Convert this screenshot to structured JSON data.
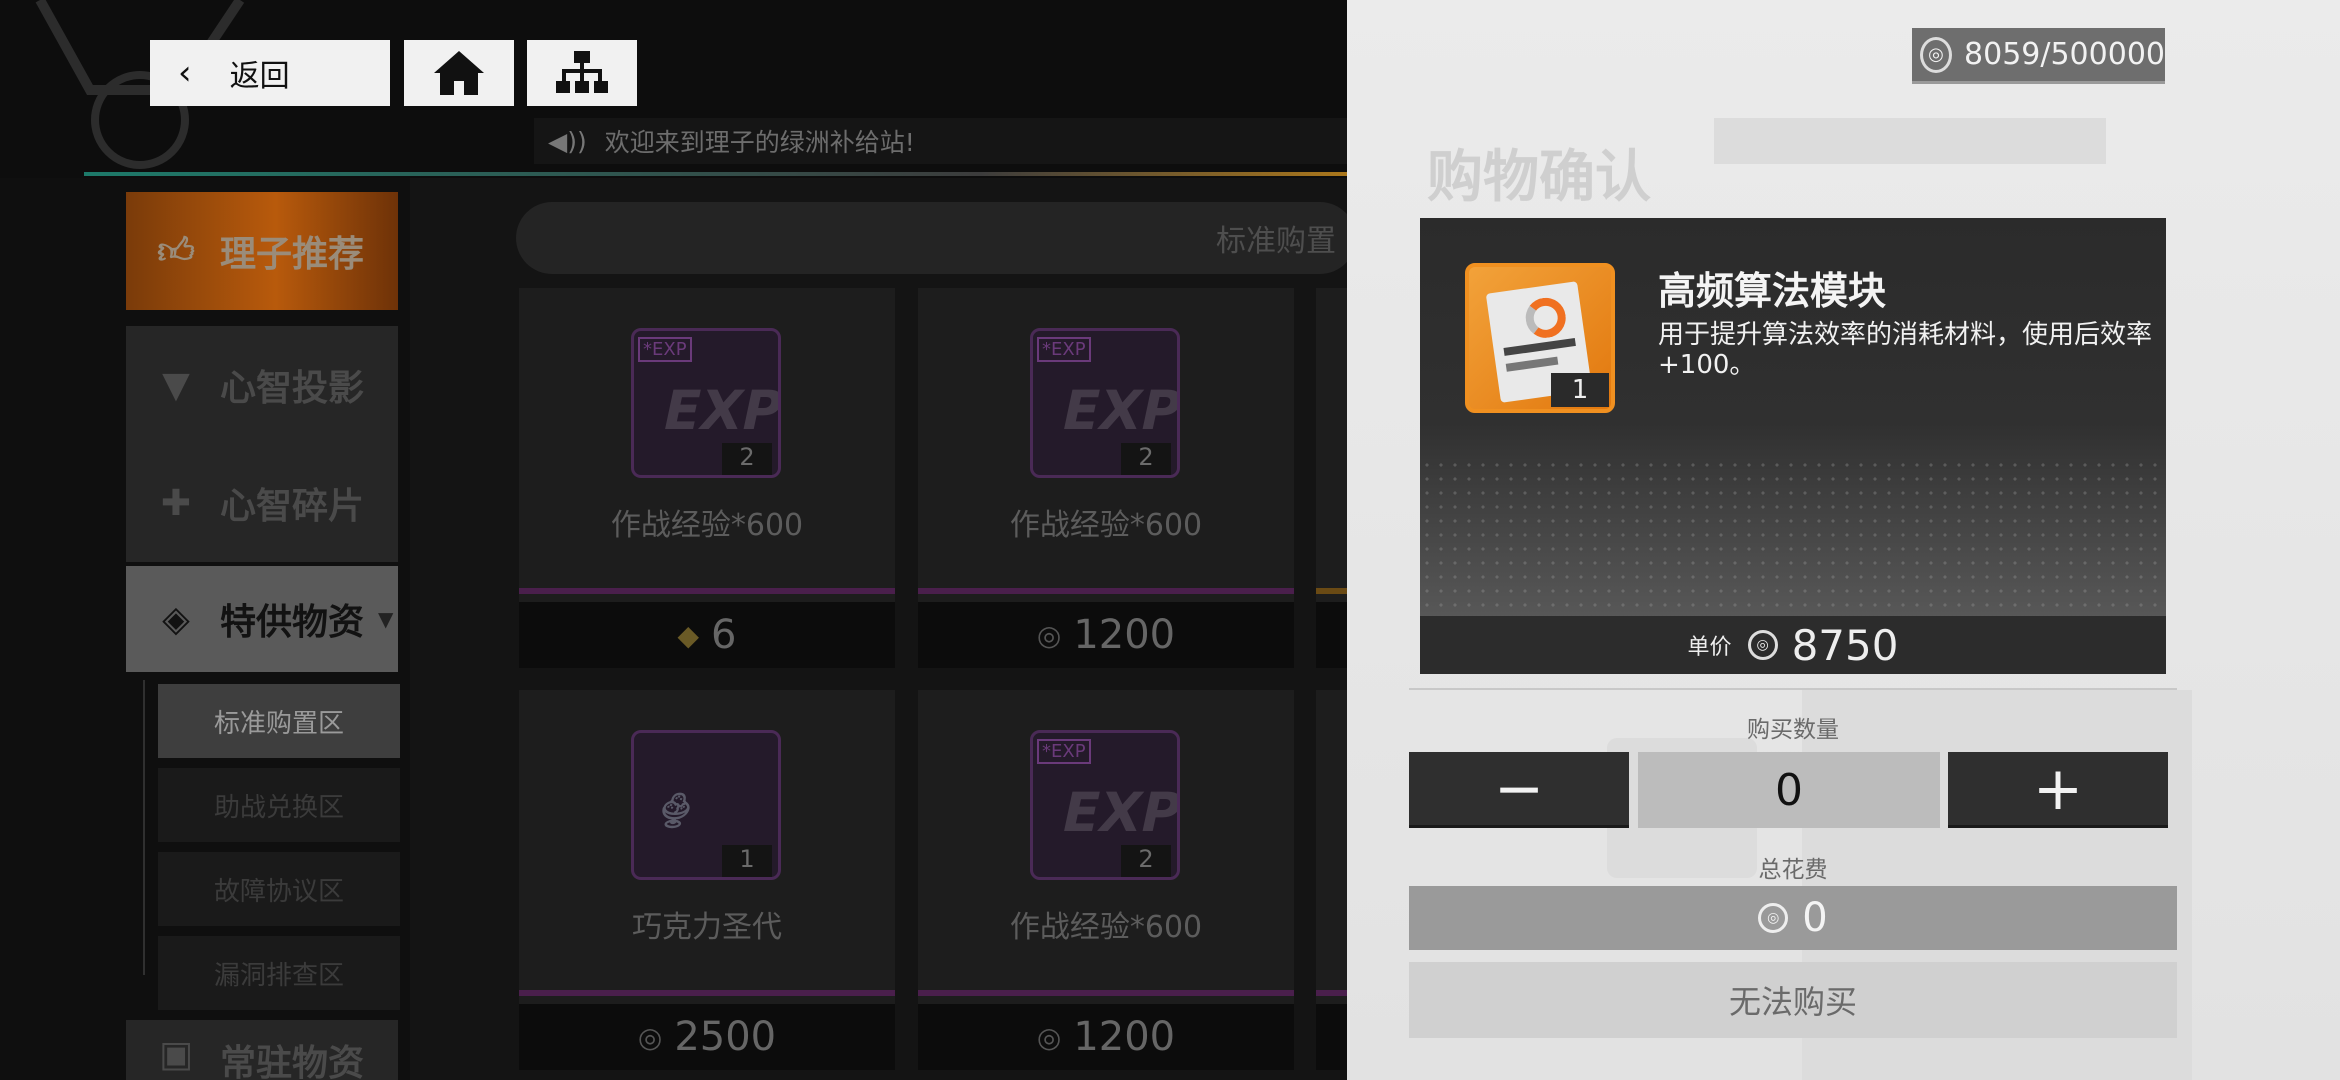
{
  "nav": {
    "back_label": "返回",
    "home_icon": "home-icon",
    "tree_icon": "sitemap-icon"
  },
  "ticker": {
    "text": "欢迎来到理子的绿洲补给站!"
  },
  "categories": [
    {
      "label": "理子推荐",
      "icon": "thumbs-up-icon"
    },
    {
      "label": "心智投影",
      "icon": "shirt-icon"
    },
    {
      "label": "心智碎片",
      "icon": "puzzle-icon"
    },
    {
      "label": "特供物资",
      "icon": "layers-icon"
    },
    {
      "label": "常驻物资",
      "icon": "box-icon"
    }
  ],
  "subcategories": [
    "标准购置区",
    "助战兑换区",
    "故障协议区",
    "漏洞排查区"
  ],
  "section_title": "标准购置",
  "shop_items": [
    {
      "name": "作战经验*600",
      "qty": "2",
      "price": "6",
      "tag": "*EXP"
    },
    {
      "name": "作战经验*600",
      "qty": "2",
      "price": "1200",
      "tag": "*EXP"
    },
    {
      "name": "巧克力圣代",
      "qty": "1",
      "price": "2500",
      "tag": ""
    },
    {
      "name": "作战经验*600",
      "qty": "2",
      "price": "1200",
      "tag": "*EXP"
    }
  ],
  "currency": {
    "display": "8059/500000"
  },
  "modal": {
    "title": "购物确认",
    "item_name": "高频算法模块",
    "item_desc": "用于提升算法效率的消耗材料，使用后效率+100。",
    "item_qty": "1",
    "unit_price_label": "单价",
    "unit_price": "8750",
    "quantity_label": "购买数量",
    "minus": "−",
    "quantity": "0",
    "plus": "+",
    "total_label": "总花费",
    "total": "0",
    "buy_label": "无法购买"
  },
  "colors": {
    "accent_orange": "#f09020",
    "dark_panel": "#2f2f2f",
    "modal_bg": "#e6e6e6"
  }
}
